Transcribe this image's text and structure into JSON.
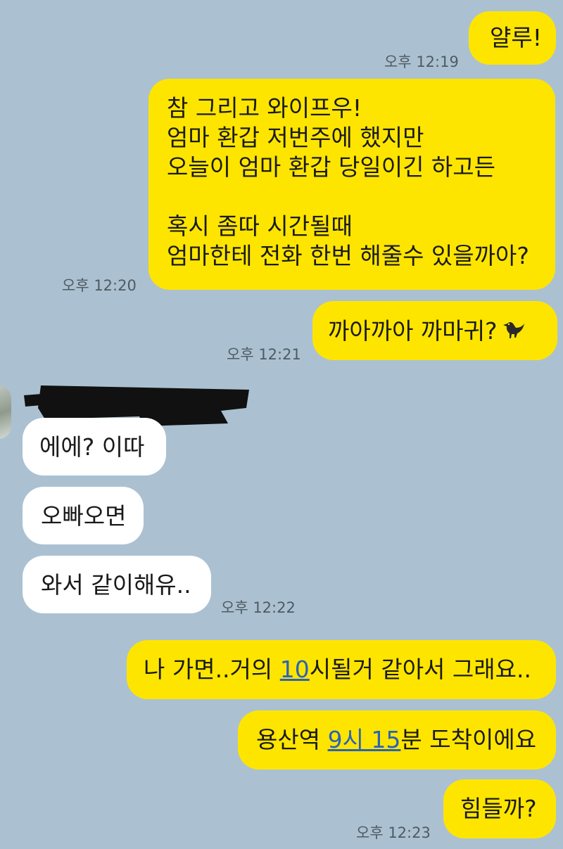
{
  "messages": [
    {
      "id": "m1",
      "text": "얄루!",
      "time": "오후 12:19"
    },
    {
      "id": "m2",
      "lines": [
        "참 그리고 와이프우!",
        "엄마 환갑 저번주에 했지만",
        "오늘이 엄마 환갑 당일이긴 하고든",
        "",
        "혹시 좀따 시간될때",
        "엄마한테 전화 한번 해줄수 있을까아?"
      ],
      "time": "오후 12:20"
    },
    {
      "id": "m3",
      "text": "까아까아 까마귀?",
      "icon": "crow-icon",
      "time": "오후 12:21"
    },
    {
      "id": "m4",
      "text": "에에? 이따"
    },
    {
      "id": "m5",
      "text": "오빠오면"
    },
    {
      "id": "m6",
      "text": "와서 같이해유..",
      "time": "오후 12:22"
    },
    {
      "id": "m7",
      "before": "나 가면..거의 ",
      "link": "10",
      "after": "시될거 같아서 그래요.."
    },
    {
      "id": "m8",
      "before": "용산역 ",
      "link": "9시 15",
      "after": "분 도착이에요"
    },
    {
      "id": "m9",
      "text": "힘들까?",
      "time": "오후 12:23"
    }
  ],
  "colors": {
    "background": "#abc1d1",
    "outgoing": "#fee500",
    "incoming": "#ffffff",
    "link": "#2b63b8"
  }
}
